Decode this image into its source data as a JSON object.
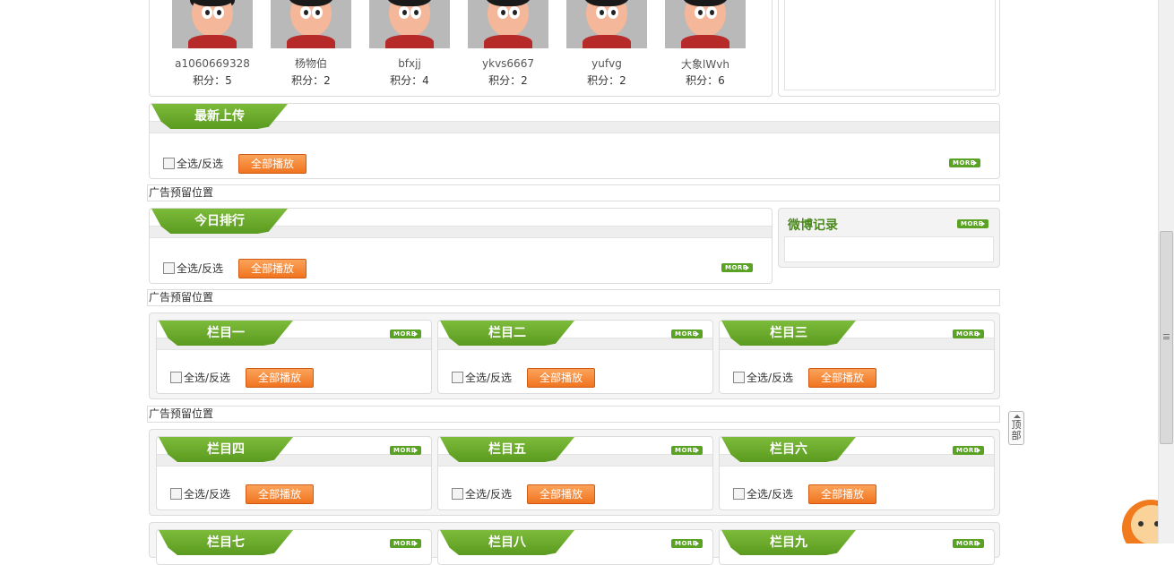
{
  "users": [
    {
      "name": "a1060669328",
      "score": "积分：5"
    },
    {
      "name": "杨物伯",
      "score": "积分：2"
    },
    {
      "name": "bfxjj",
      "score": "积分：4"
    },
    {
      "name": "ykvs6667",
      "score": "积分：2"
    },
    {
      "name": "yufvg",
      "score": "积分：2"
    },
    {
      "name": "大象lWvh",
      "score": "积分：6"
    }
  ],
  "common": {
    "select_all": "全选/反选",
    "play_all": "全部播放",
    "more": "MORE",
    "ad_text": "广告预留位置",
    "back_to_top": "顶部"
  },
  "sections": {
    "latest_upload": "最新上传",
    "today_rank": "今日排行",
    "weibo": "微博记录"
  },
  "columns": [
    "栏目一",
    "栏目二",
    "栏目三",
    "栏目四",
    "栏目五",
    "栏目六",
    "栏目七",
    "栏目八",
    "栏目九"
  ],
  "colors": {
    "green": "#5a9a1f",
    "orange": "#f07420"
  }
}
